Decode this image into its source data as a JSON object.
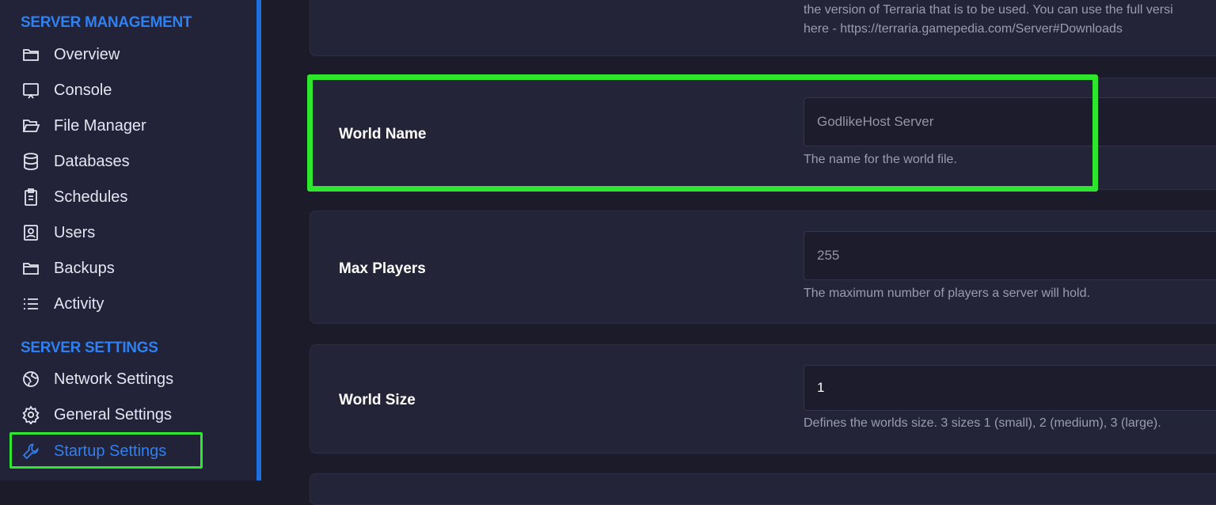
{
  "sidebar": {
    "management_title": "SERVER MANAGEMENT",
    "management_items": [
      {
        "label": "Overview",
        "icon": "folder-icon"
      },
      {
        "label": "Console",
        "icon": "console-icon"
      },
      {
        "label": "File Manager",
        "icon": "folder-open-icon"
      },
      {
        "label": "Databases",
        "icon": "database-icon"
      },
      {
        "label": "Schedules",
        "icon": "clipboard-icon"
      },
      {
        "label": "Users",
        "icon": "user-badge-icon"
      },
      {
        "label": "Backups",
        "icon": "folder-icon"
      },
      {
        "label": "Activity",
        "icon": "list-icon"
      }
    ],
    "settings_title": "SERVER SETTINGS",
    "settings_items": [
      {
        "label": "Network Settings",
        "icon": "globe-icon"
      },
      {
        "label": "General Settings",
        "icon": "gear-icon"
      },
      {
        "label": "Startup Settings",
        "icon": "wrench-icon",
        "active": true
      }
    ]
  },
  "main": {
    "top_card": {
      "description_line1": "the version of Terraria that is to be used. You can use the full versi",
      "description_line2": "here - https://terraria.gamepedia.com/Server#Downloads"
    },
    "variables": [
      {
        "label": "World Name",
        "value": "GodlikeHost Server",
        "description": "The name for the world file."
      },
      {
        "label": "Max Players",
        "value": "255",
        "description": "The maximum number of players a server will hold."
      },
      {
        "label": "World Size",
        "value": "1",
        "description": "Defines the worlds size. 3 sizes 1 (small), 2 (medium), 3 (large)."
      }
    ]
  },
  "colors": {
    "accent": "#2f80f0",
    "highlight": "#2ee62e",
    "background": "#1b1b2a",
    "sidebar": "#222238"
  }
}
